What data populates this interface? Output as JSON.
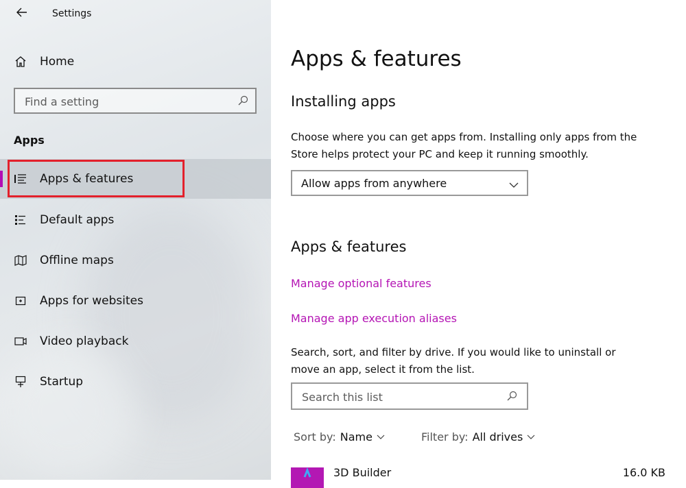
{
  "window": {
    "app_title": "Settings"
  },
  "sidebar": {
    "home_label": "Home",
    "search_placeholder": "Find a setting",
    "section_heading": "Apps",
    "items": [
      {
        "label": "Apps & features",
        "icon": "apps-features-list-icon",
        "selected": true
      },
      {
        "label": "Default apps",
        "icon": "default-apps-list-icon",
        "selected": false
      },
      {
        "label": "Offline maps",
        "icon": "map-icon",
        "selected": false
      },
      {
        "label": "Apps for websites",
        "icon": "link-box-icon",
        "selected": false
      },
      {
        "label": "Video playback",
        "icon": "video-icon",
        "selected": false
      },
      {
        "label": "Startup",
        "icon": "startup-icon",
        "selected": false
      }
    ]
  },
  "main": {
    "page_title": "Apps & features",
    "installing": {
      "heading": "Installing apps",
      "description_line1": "Choose where you can get apps from. Installing only apps from the",
      "description_line2": "Store helps protect your PC and keep it running smoothly.",
      "dropdown_value": "Allow apps from anywhere"
    },
    "apps_section": {
      "heading": "Apps & features",
      "link_optional": "Manage optional features",
      "link_aliases": "Manage app execution aliases",
      "description_line1": "Search, sort, and filter by drive. If you would like to uninstall or",
      "description_line2": "move an app, select it from the list.",
      "search_placeholder": "Search this list",
      "sort_label": "Sort by:",
      "sort_value": "Name",
      "filter_label": "Filter by:",
      "filter_value": "All drives"
    },
    "apps": [
      {
        "name": "3D Builder",
        "size": "16.0 KB"
      }
    ]
  },
  "colors": {
    "accent": "#b414b4",
    "highlight_box": "#e3202b"
  }
}
